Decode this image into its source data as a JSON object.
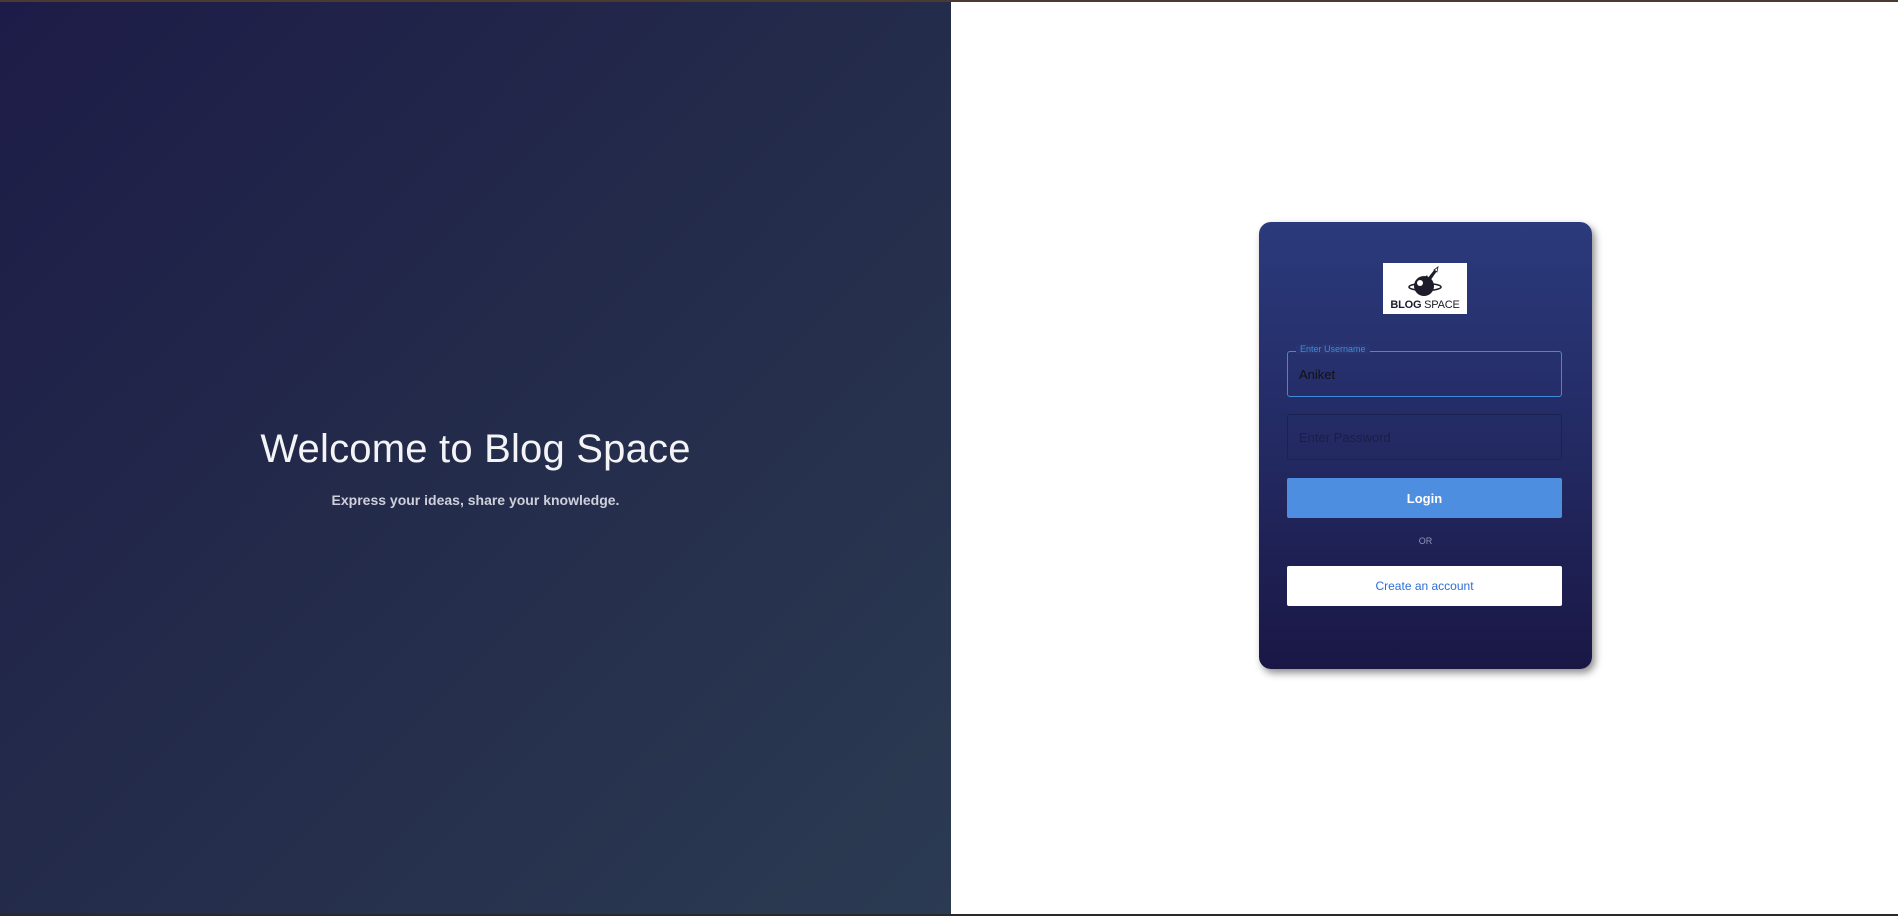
{
  "hero": {
    "title": "Welcome to Blog Space",
    "subtitle": "Express your ideas, share your knowledge."
  },
  "logo": {
    "text_bold": "BLOG",
    "text_light": "SPACE",
    "icon": "rocket-globe-icon"
  },
  "login_form": {
    "username_label": "Enter Username",
    "username_value": "Aniket",
    "password_placeholder": "Enter Password",
    "login_label": "Login",
    "or_text": "OR",
    "create_account_label": "Create an account"
  },
  "colors": {
    "accent": "#4d8ee0",
    "focus_border": "#3d8bd9",
    "link": "#2c6ed6",
    "card_top": "#2b3a7c",
    "card_bottom": "#1a1745",
    "left_panel_start": "#1d1c48",
    "left_panel_end": "#2b3b52"
  }
}
